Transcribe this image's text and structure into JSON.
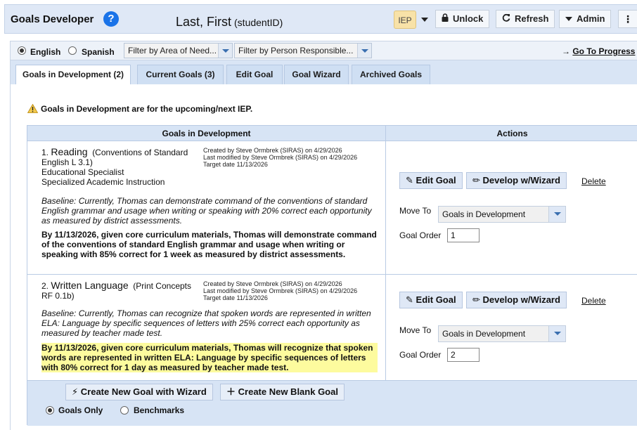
{
  "header": {
    "title": "Goals Developer",
    "help_icon": "?",
    "student_name": "Last, First",
    "student_id": "(studentID)",
    "iep_label": "IEP",
    "buttons": {
      "unlock": "Unlock",
      "refresh": "Refresh",
      "admin": "Admin"
    }
  },
  "filters": {
    "languages": [
      "English",
      "Spanish"
    ],
    "selected_language": "English",
    "area_filter": "Filter by Area of Need...",
    "person_filter": "Filter by Person Responsible...",
    "progress_link": "Go To Progress"
  },
  "tabs": [
    {
      "label": "Goals in Development (2)",
      "active": true
    },
    {
      "label": "Current Goals (3)",
      "active": false
    },
    {
      "label": "Edit Goal",
      "active": false
    },
    {
      "label": "Goal Wizard",
      "active": false
    },
    {
      "label": "Archived Goals",
      "active": false
    }
  ],
  "notice": "Goals in Development are for the upcoming/next IEP.",
  "table": {
    "col_goals": "Goals in Development",
    "col_actions": "Actions"
  },
  "goals": [
    {
      "number": "1.",
      "area": "Reading",
      "standard": "(Conventions of Standard English L 3.1)",
      "provider": "Educational Specialist",
      "service": "Specialized Academic Instruction",
      "created": "Created by Steve Ormbrek (SIRAS) on 4/29/2026",
      "modified": "Last modified by Steve Ormbrek (SIRAS) on 4/29/2026",
      "target": "Target date 11/13/2026",
      "baseline": "Baseline: Currently, Thomas can demonstrate command of the conventions of standard English grammar and usage when writing or speaking with 20% correct each opportunity as measured by district assessments.",
      "statement": "By 11/13/2026, given core curriculum materials, Thomas will demonstrate command of the conventions of standard English grammar and usage when writing or speaking with 85% correct for 1 week as measured by district assessments.",
      "highlighted": false,
      "move_to": "Goals in Development",
      "order": "1"
    },
    {
      "number": "2.",
      "area": "Written Language",
      "standard": "(Print Concepts RF 0.1b)",
      "created": "Created by Steve Ormbrek (SIRAS) on 4/29/2026",
      "modified": "Last modified by Steve Ormbrek (SIRAS) on 4/29/2026",
      "target": "Target date 11/13/2026",
      "baseline": "Baseline: Currently, Thomas can recognize that spoken words are represented in written ELA: Language by specific sequences of letters with 25% correct each opportunity as measured by teacher made test.",
      "statement": "By 11/13/2026, given core curriculum materials, Thomas will recognize that spoken words are represented in written ELA: Language by specific sequences of letters with 80% correct for 1 day as measured by teacher made test.",
      "highlighted": true,
      "move_to": "Goals in Development",
      "order": "2"
    }
  ],
  "actions": {
    "edit_goal": "Edit Goal",
    "develop_wizard": "Develop w/Wizard",
    "delete": "Delete",
    "move_to_label": "Move To",
    "goal_order_label": "Goal Order"
  },
  "footer": {
    "create_wizard": "Create New Goal with Wizard",
    "create_blank": "Create New Blank Goal",
    "view_options": [
      "Goals Only",
      "Benchmarks"
    ],
    "selected_view": "Goals Only"
  },
  "colors": {
    "header_bg": "#dfe8f6",
    "tab_bg": "#cfdff3",
    "highlight": "#fdfb9e",
    "help_blue": "#1a73e8"
  }
}
